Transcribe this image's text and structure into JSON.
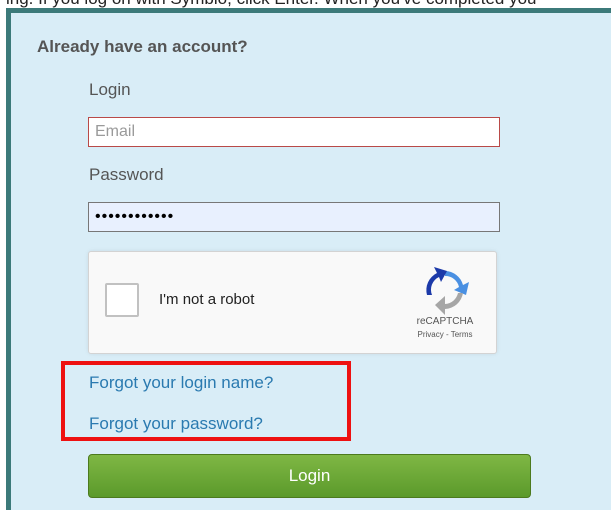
{
  "top_strip_text": "ing. If you log on with Symbio, click Enter. When you've completed you",
  "heading": "Already have an account?",
  "login": {
    "label": "Login",
    "email_placeholder": "Email"
  },
  "password": {
    "label": "Password",
    "value": "password1234"
  },
  "recaptcha": {
    "label": "I'm not a robot",
    "brand": "reCAPTCHA",
    "privacy": "Privacy",
    "separator": " - ",
    "terms": "Terms"
  },
  "links": {
    "forgot_login": "Forgot your login name?",
    "forgot_password": "Forgot your password?"
  },
  "submit_label": "Login",
  "colors": {
    "panel_bg": "#d9edf7",
    "panel_border": "#3c7a7a",
    "link": "#2a7ab0",
    "highlight": "#ee1111",
    "button": "#6aa636"
  }
}
